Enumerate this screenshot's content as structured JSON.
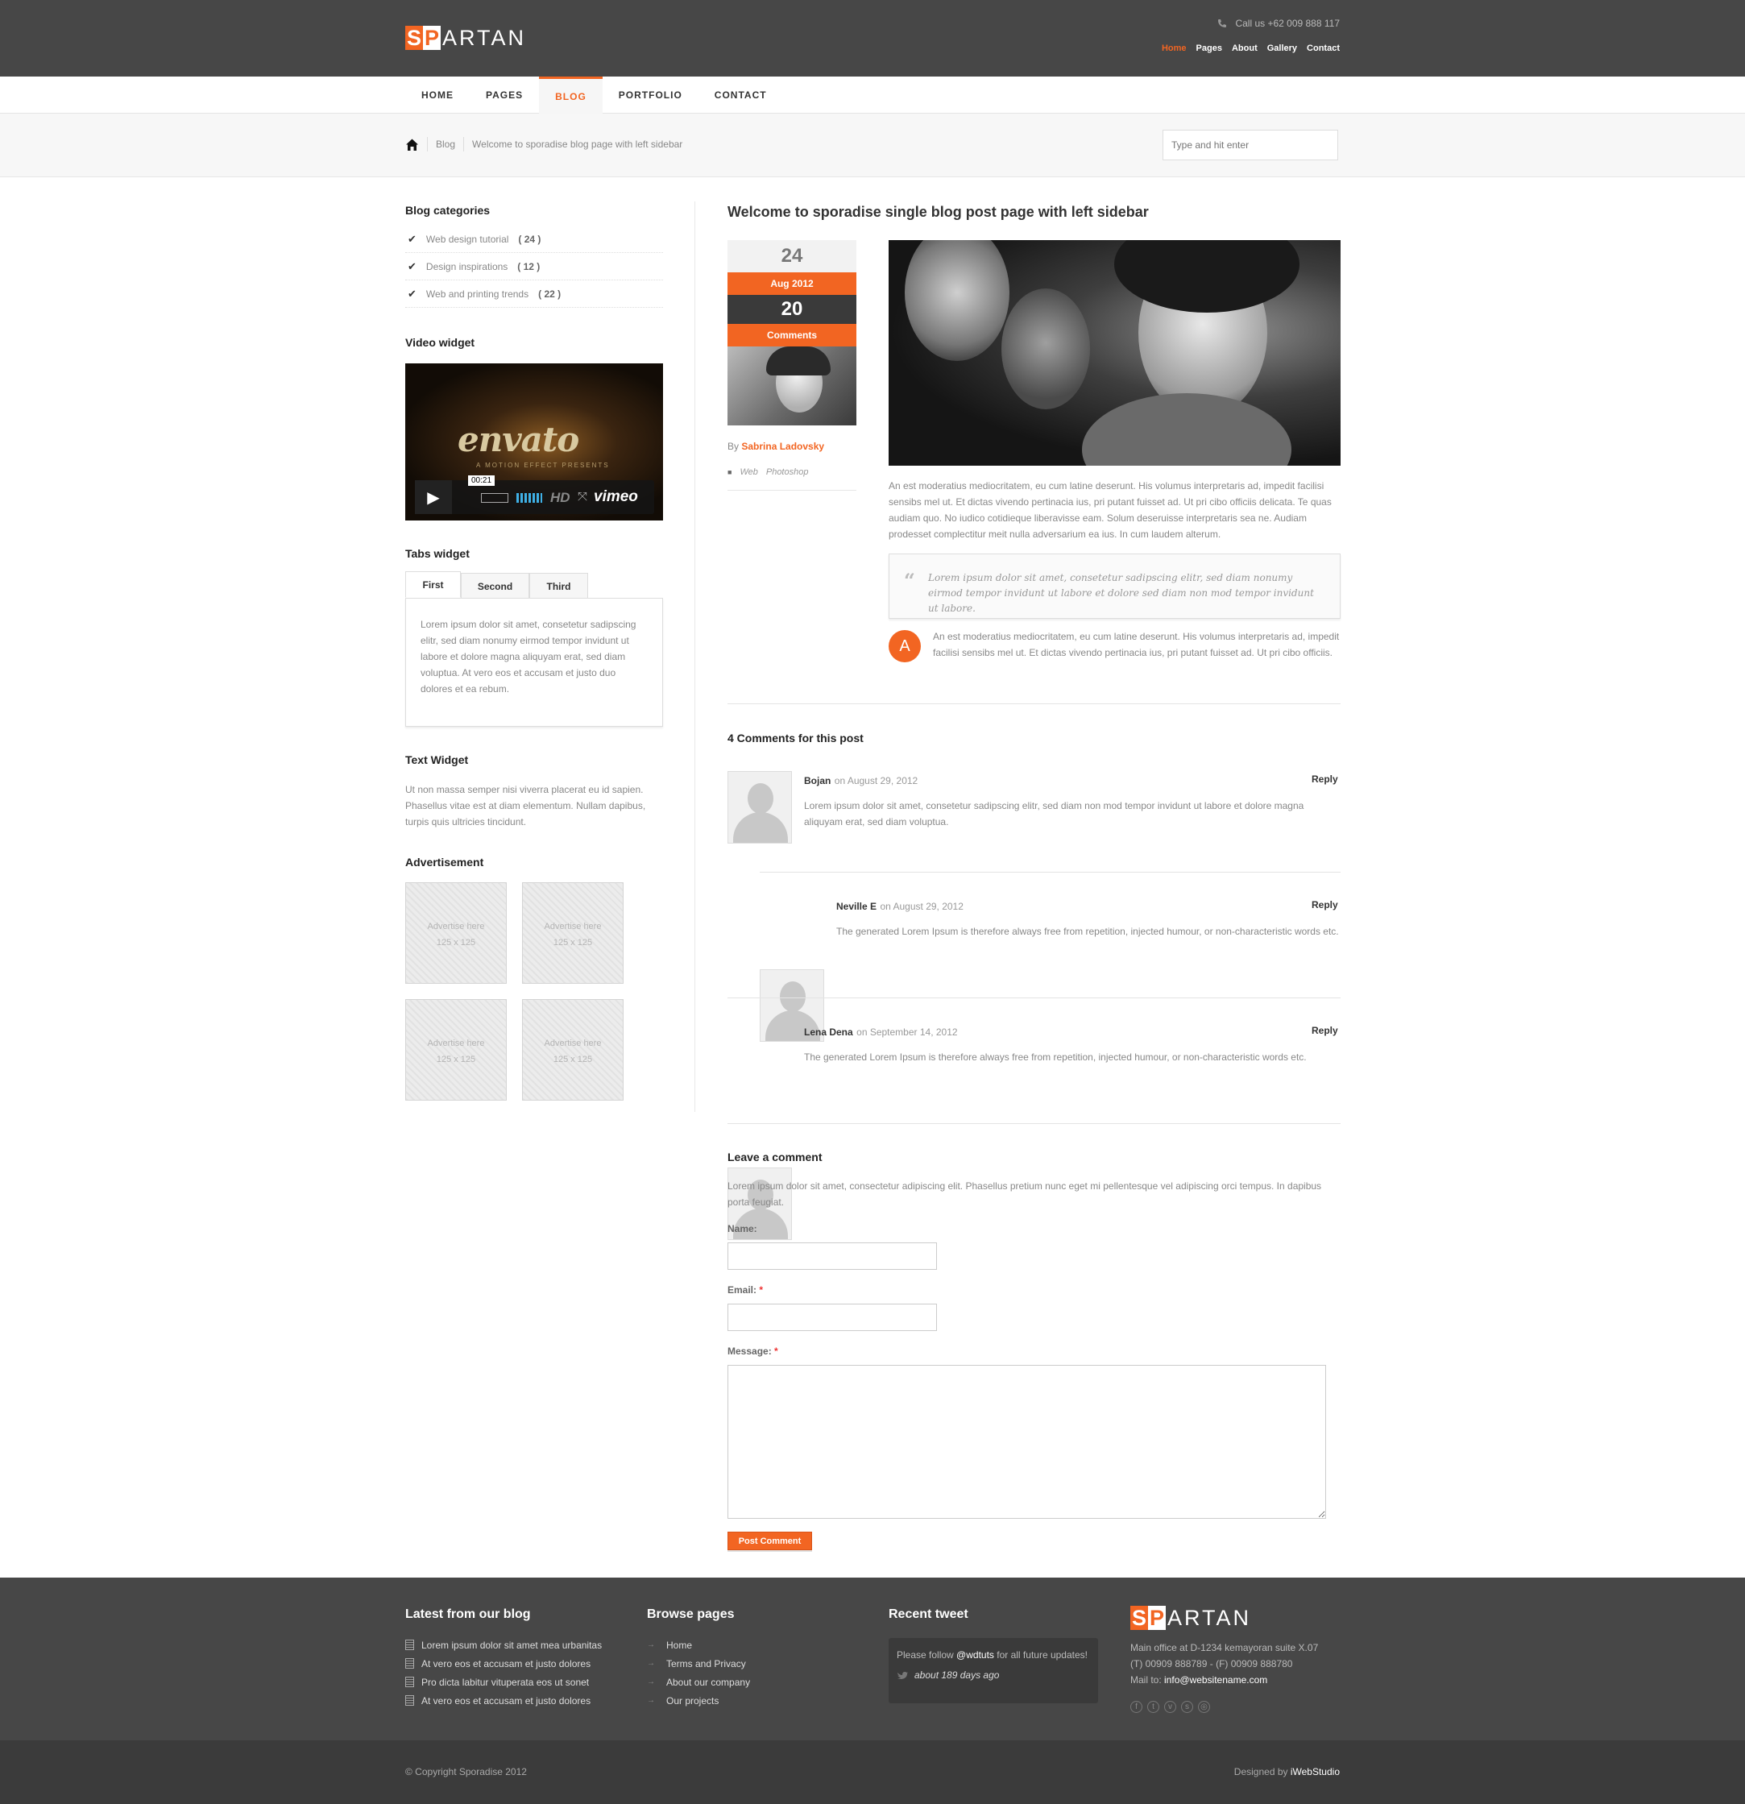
{
  "header": {
    "logo": {
      "s": "S",
      "p": "P",
      "rest": "ARTAN"
    },
    "phone": "Call us +62 009 888 117",
    "top_nav": [
      {
        "label": "Home",
        "active": true
      },
      {
        "label": "Pages",
        "active": false
      },
      {
        "label": "About",
        "active": false
      },
      {
        "label": "Gallery",
        "active": false
      },
      {
        "label": "Contact",
        "active": false
      }
    ]
  },
  "main_nav": [
    {
      "label": "HOME",
      "active": false
    },
    {
      "label": "PAGES",
      "active": false
    },
    {
      "label": "BLOG",
      "active": true
    },
    {
      "label": "PORTFOLIO",
      "active": false
    },
    {
      "label": "CONTACT",
      "active": false
    }
  ],
  "breadcrumb": {
    "items": [
      "Blog",
      "Welcome to sporadise blog page with left sidebar"
    ]
  },
  "search": {
    "placeholder": "Type and hit enter"
  },
  "sidebar": {
    "categories": {
      "title": "Blog categories",
      "items": [
        {
          "label": "Web design tutorial",
          "count": "( 24 )"
        },
        {
          "label": "Design inspirations",
          "count": "( 12 )"
        },
        {
          "label": "Web and printing trends",
          "count": "( 22 )"
        }
      ]
    },
    "video": {
      "title": "Video widget",
      "brand": "envato",
      "sub": "A MOTION EFFECT PRESENTS",
      "time": "00:21",
      "hd": "HD",
      "provider": "vimeo"
    },
    "tabs": {
      "title": "Tabs widget",
      "items": [
        "First",
        "Second",
        "Third"
      ],
      "content": "Lorem ipsum dolor sit amet, consetetur sadipscing elitr, sed diam nonumy eirmod tempor invidunt ut labore et dolore magna aliquyam erat, sed diam voluptua. At vero eos et accusam et justo duo dolores et ea rebum."
    },
    "text_widget": {
      "title": "Text Widget",
      "body": "Ut non massa semper nisi viverra placerat eu id sapien. Phasellus vitae est at diam elementum. Nullam dapibus, turpis quis ultricies tincidunt."
    },
    "advertisement": {
      "title": "Advertisement",
      "ads": [
        {
          "line1": "Advertise here",
          "line2": "125 x 125"
        },
        {
          "line1": "Advertise here",
          "line2": "125 x 125"
        },
        {
          "line1": "Advertise here",
          "line2": "125 x 125"
        },
        {
          "line1": "Advertise here",
          "line2": "125 x 125"
        }
      ]
    }
  },
  "post": {
    "title": "Welcome to sporadise single blog post page with left sidebar",
    "day": "24",
    "month": "Aug 2012",
    "comment_count": "20",
    "comments_label": "Comments",
    "by": "By",
    "author": "Sabrina Ladovsky",
    "tags": [
      "Web",
      "Photoshop"
    ],
    "para1": "An est moderatius mediocritatem, eu cum latine deserunt. His volumus interpretaris ad, impedit facilisi sensibs mel ut. Et dictas vivendo pertinacia ius, pri putant fuisset ad. Ut pri cibo officiis delicata. Te quas audiam quo. No iudico cotidieque liberavisse eam. Solum deseruisse interpretaris sea ne. Audiam prodesset complectitur meit nulla adversarium ea ius. In cum laudem alterum.",
    "quote": "Lorem ipsum dolor sit amet, consetetur sadipscing elitr, sed diam nonumy eirmod tempor invidunt ut labore et dolore sed diam non mod tempor invidunt ut labore.",
    "dropcap": "A",
    "para2": "An est moderatius mediocritatem, eu cum latine deserunt. His volumus interpretaris ad, impedit facilisi sensibs mel ut. Et dictas vivendo pertinacia ius, pri putant fuisset ad. Ut pri cibo officiis."
  },
  "comments": {
    "title": "4 Comments for this post",
    "reply_label": "Reply",
    "items": [
      {
        "name": "Bojan",
        "date": "on August 29, 2012",
        "text": "Lorem ipsum dolor sit amet, consetetur sadipscing elitr, sed diam non mod tempor invidunt ut labore et dolore magna aliquyam erat, sed diam voluptua."
      },
      {
        "name": "Neville E",
        "date": "on August 29, 2012",
        "text": "The generated Lorem Ipsum is therefore always free from repetition, injected humour, or non-characteristic words etc."
      },
      {
        "name": "Lena Dena",
        "date": "on September 14, 2012",
        "text": "The generated Lorem Ipsum is therefore always free from repetition, injected humour, or non-characteristic words etc."
      }
    ]
  },
  "leave_comment": {
    "title": "Leave a comment",
    "intro": "Lorem ipsum dolor sit amet, consectetur adipiscing elit. Phasellus pretium nunc eget mi pellentesque vel adipiscing orci tempus. In dapibus porta feugiat.",
    "name_label": "Name:",
    "email_label": "Email:",
    "message_label": "Message:",
    "required_mark": "*",
    "name_value": "",
    "email_value": "",
    "submit": "Post Comment"
  },
  "footer": {
    "blog": {
      "title": "Latest from our blog",
      "items": [
        "Lorem ipsum dolor sit amet mea urbanitas",
        "At vero eos et accusam et justo dolores",
        "Pro dicta labitur vituperata eos ut sonet",
        "At vero eos et accusam et justo dolores"
      ]
    },
    "pages": {
      "title": "Browse pages",
      "items": [
        "Home",
        "Terms and Privacy",
        "About our company",
        "Our projects"
      ]
    },
    "tweet": {
      "title": "Recent tweet",
      "pre": "Please follow ",
      "handle": "@wdtuts",
      "post": " for all future updates!",
      "when": "about 189 days ago"
    },
    "contact": {
      "address": "Main office at D-1234 kemayoran suite X.07",
      "phones": "(T) 00909 888789 - (F) 00909 888780",
      "mail_label": "Mail to: ",
      "mail": "info@websitename.com"
    },
    "social": [
      "facebook-icon",
      "twitter-icon",
      "vimeo-icon",
      "skype-icon",
      "dribbble-icon"
    ],
    "copyright": "© Copyright Sporadise 2012",
    "designed_by": "Designed by ",
    "designer": "iWebStudio"
  },
  "colors": {
    "accent": "#f26522",
    "header_bg": "#474747",
    "footer_bg": "#474747",
    "subfooter_bg": "#3b3b3b"
  }
}
